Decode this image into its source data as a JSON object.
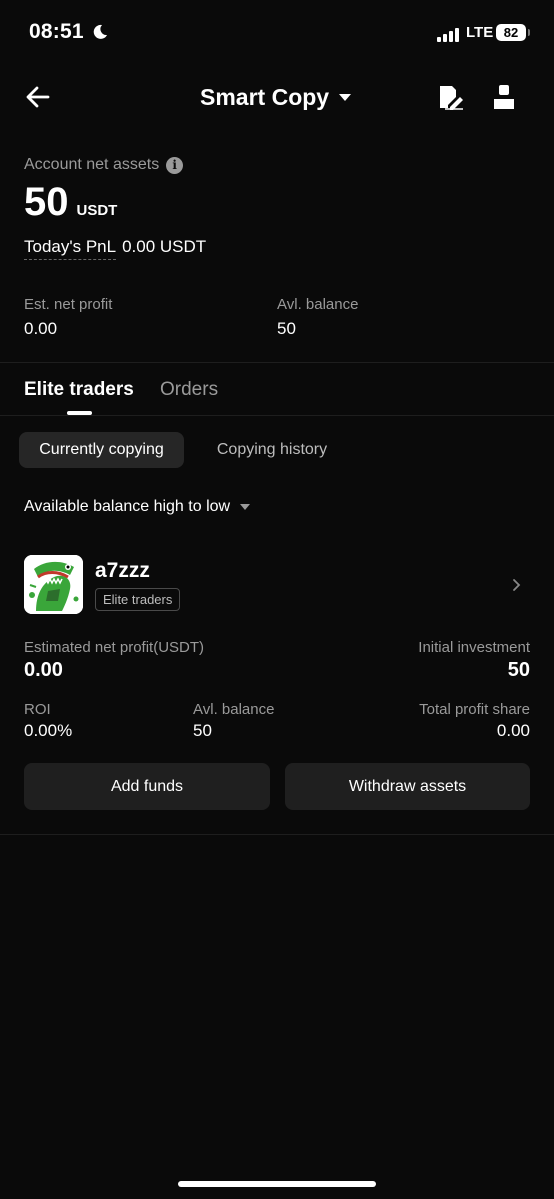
{
  "status_bar": {
    "time": "08:51",
    "network": "LTE",
    "battery": "82"
  },
  "nav": {
    "title": "Smart Copy"
  },
  "account": {
    "net_assets_label": "Account net assets",
    "net_assets_value": "50",
    "net_assets_unit": "USDT",
    "pnl_label": "Today's PnL",
    "pnl_value": "0.00 USDT",
    "est_profit_label": "Est. net profit",
    "est_profit_value": "0.00",
    "avl_balance_label": "Avl. balance",
    "avl_balance_value": "50"
  },
  "tabs": [
    {
      "label": "Elite traders",
      "active": true
    },
    {
      "label": "Orders",
      "active": false
    }
  ],
  "filters": [
    {
      "label": "Currently copying",
      "active": true
    },
    {
      "label": "Copying history",
      "active": false
    }
  ],
  "sort": {
    "label": "Available balance high to low"
  },
  "trader": {
    "name": "a7zzz",
    "badge": "Elite traders",
    "est_profit_label": "Estimated net profit(USDT)",
    "est_profit_value": "0.00",
    "initial_investment_label": "Initial investment",
    "initial_investment_value": "50",
    "roi_label": "ROI",
    "roi_value": "0.00%",
    "avl_balance_label": "Avl. balance",
    "avl_balance_value": "50",
    "total_profit_share_label": "Total profit share",
    "total_profit_share_value": "0.00",
    "add_funds_label": "Add funds",
    "withdraw_label": "Withdraw assets"
  },
  "colors": {
    "background": "#0a0a0a",
    "card_button": "#1f1f1f",
    "muted_text": "#9a9a9a",
    "avatar_green": "#3aa63a"
  }
}
